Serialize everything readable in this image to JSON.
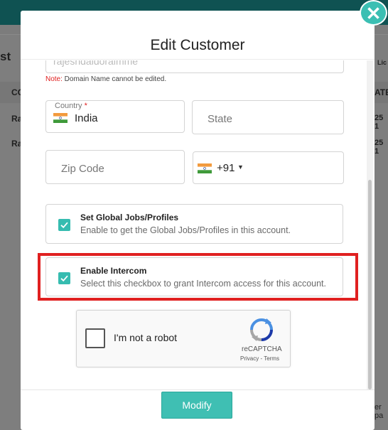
{
  "background": {
    "left_fragment": "st",
    "col_fragment": "CO",
    "row1_fragment": "Ra",
    "row2_fragment": "Ra",
    "right_col_fragment": "ATE",
    "right_row1_fragment": "25 1",
    "right_row2_fragment": "25 1",
    "right_top_fragment": "Lic",
    "right_bottom_fragment": "er pa"
  },
  "modal": {
    "title": "Edit Customer",
    "close_icon": "close-icon",
    "domain": {
      "value": "rajeshdaidoraimme",
      "note_prefix": "Note:",
      "note_text": " Domain Name cannot be edited."
    },
    "country": {
      "label": "Country",
      "required_mark": "*",
      "value": "India",
      "flag_icon": "india-flag-icon"
    },
    "state": {
      "placeholder": "State"
    },
    "zip": {
      "placeholder": "Zip Code"
    },
    "phone": {
      "code": "+91",
      "caret": "▼",
      "flag_icon": "india-flag-icon"
    },
    "global_jobs": {
      "title": "Set Global Jobs/Profiles",
      "description": "Enable to get the Global Jobs/Profiles in this account.",
      "checked": true
    },
    "intercom": {
      "title": "Enable Intercom",
      "description": "Select this checkbox to grant Intercom access for this account.",
      "checked": true
    },
    "recaptcha": {
      "label": "I'm not a robot",
      "brand": "reCAPTCHA",
      "links": "Privacy - Terms"
    },
    "submit_label": "Modify"
  },
  "colors": {
    "accent": "#3bbfb3",
    "highlight": "#e02020",
    "header_bar": "#0f5252"
  }
}
